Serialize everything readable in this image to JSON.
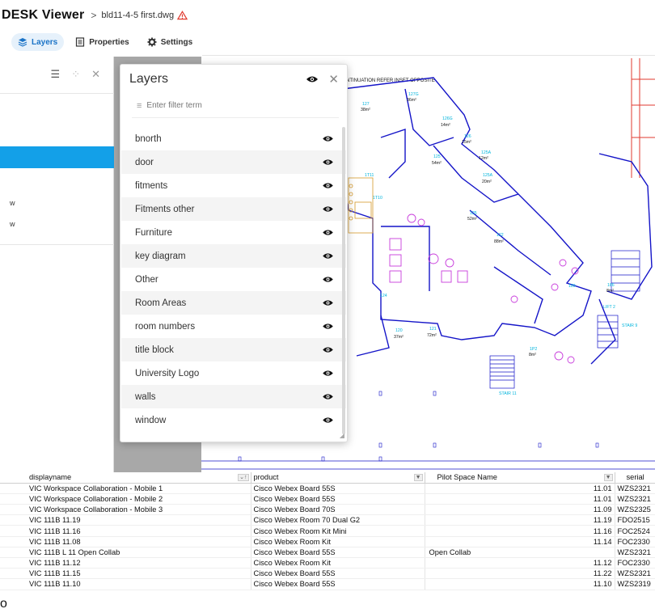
{
  "header": {
    "brand": "DESK Viewer",
    "crumb_separator": ">",
    "file_name": "bld11-4-5 first.dwg"
  },
  "toolbar": {
    "tabs": [
      {
        "label": "Layers",
        "icon": "layers-icon",
        "active": true
      },
      {
        "label": "Properties",
        "icon": "properties-icon",
        "active": false
      },
      {
        "label": "Settings",
        "icon": "gear-icon",
        "active": false
      }
    ]
  },
  "left_panel": {
    "items": [
      "w",
      "w"
    ]
  },
  "drawing": {
    "note_text": "NTINUATION REFER INSET OPPOSITE",
    "rooms": [
      {
        "num": "127",
        "area": "38m²"
      },
      {
        "num": "127G",
        "area": "36m²"
      },
      {
        "num": "126G",
        "area": "14m²"
      },
      {
        "num": "126",
        "area": "15m²"
      },
      {
        "num": "125A",
        "area": "12m²"
      },
      {
        "num": "125A",
        "area": "20m²"
      },
      {
        "num": "125",
        "area": "54m²"
      },
      {
        "num": "125",
        "area": "52m²"
      },
      {
        "num": "122",
        "area": "88m²"
      },
      {
        "num": "120",
        "area": "37m²"
      },
      {
        "num": "121",
        "area": "72m²"
      },
      {
        "num": "186",
        "area": "8m²"
      },
      {
        "num": "1P2",
        "area": "8m²"
      }
    ],
    "labels": [
      "LIFT 2",
      "STAIR 9",
      "STAIR 11",
      "1T10",
      "1T11",
      "125",
      "189",
      "124"
    ]
  },
  "layers_panel": {
    "title": "Layers",
    "filter_placeholder": "Enter filter term",
    "layers": [
      "bnorth",
      "door",
      "fitments",
      "Fitments other",
      "Furniture",
      "key diagram",
      "Other",
      "Room Areas",
      "room numbers",
      "title block",
      "University Logo",
      "walls",
      "window"
    ]
  },
  "table": {
    "columns": [
      "displayname",
      "product",
      "Pilot Space Name",
      "serial"
    ],
    "rows": [
      {
        "displayname": "VIC Workspace Collaboration - Mobile 1",
        "product": "Cisco Webex Board 55S",
        "pilot": "",
        "num": "11.01",
        "serial": "WZS2321"
      },
      {
        "displayname": "VIC Workspace Collaboration - Mobile 2",
        "product": "Cisco Webex Board 55S",
        "pilot": "",
        "num": "11.01",
        "serial": "WZS2321"
      },
      {
        "displayname": "VIC Workspace Collaboration - Mobile 3",
        "product": "Cisco Webex Board 70S",
        "pilot": "",
        "num": "11.09",
        "serial": "WZS2325"
      },
      {
        "displayname": "VIC 111B 11.19",
        "product": "Cisco Webex Room 70 Dual G2",
        "pilot": "",
        "num": "11.19",
        "serial": "FDO2515"
      },
      {
        "displayname": "VIC 111B 11.16",
        "product": "Cisco Webex Room Kit Mini",
        "pilot": "",
        "num": "11.16",
        "serial": "FOC2524"
      },
      {
        "displayname": "VIC 111B 11.08",
        "product": "Cisco Webex Room Kit",
        "pilot": "",
        "num": "11.14",
        "serial": "FOC2330"
      },
      {
        "displayname": "VIC 111B L 11 Open Collab",
        "product": "Cisco Webex Board 55S",
        "pilot": "Open Collab",
        "num": "",
        "serial": "WZS2321"
      },
      {
        "displayname": "VIC 111B 11.12",
        "product": "Cisco Webex Room Kit",
        "pilot": "",
        "num": "11.12",
        "serial": "FOC2330"
      },
      {
        "displayname": "VIC 111B 11.15",
        "product": "Cisco Webex Board 55S",
        "pilot": "",
        "num": "11.22",
        "serial": "WZS2321"
      },
      {
        "displayname": "VIC 111B 11.10",
        "product": "Cisco Webex Board 55S",
        "pilot": "",
        "num": "11.10",
        "serial": "WZS2319"
      }
    ]
  },
  "left_glyph": "o",
  "colors": {
    "accent": "#1a73c7",
    "selected_row": "#13a0e8",
    "wall_blue": "#1414c8",
    "annotation_cyan": "#00b4dc",
    "furniture_magenta": "#c83cdc",
    "warning": "#e03a2f"
  }
}
